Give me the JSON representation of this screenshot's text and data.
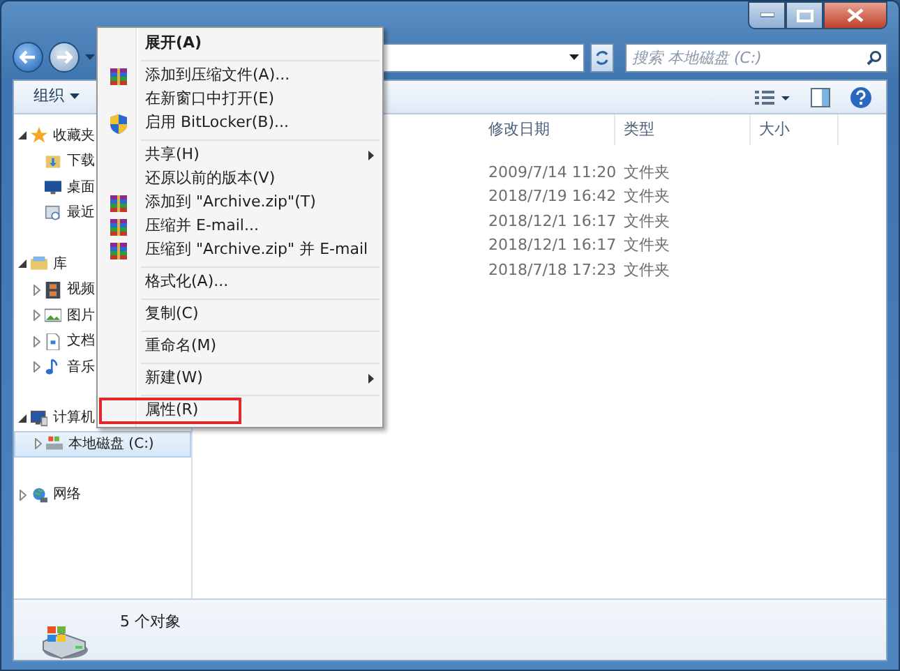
{
  "search": {
    "placeholder": "搜索 本地磁盘 (C:)"
  },
  "toolbar": {
    "organize": "组织"
  },
  "sidebar": [
    {
      "label": "收藏夹",
      "expanded": true,
      "selected": false,
      "children": [
        {
          "label": "下载",
          "selected": false
        },
        {
          "label": "桌面",
          "selected": false
        },
        {
          "label": "最近",
          "selected": false
        }
      ]
    },
    {
      "label": "库",
      "expanded": true,
      "selected": false,
      "children": [
        {
          "label": "视频",
          "expanded": false,
          "selected": false
        },
        {
          "label": "图片",
          "expanded": false,
          "selected": false
        },
        {
          "label": "文档",
          "expanded": false,
          "selected": false
        },
        {
          "label": "音乐",
          "expanded": false,
          "selected": false
        }
      ]
    },
    {
      "label": "计算机",
      "expanded": true,
      "selected": false,
      "children": [
        {
          "label": "本地磁盘 (C:)",
          "expanded": false,
          "selected": true
        }
      ]
    },
    {
      "label": "网络",
      "expanded": false,
      "selected": false
    }
  ],
  "table": {
    "columns": [
      "修改日期",
      "类型",
      "大小"
    ],
    "rows": [
      {
        "modified": "2009/7/14 11:20",
        "type": "文件夹"
      },
      {
        "modified": "2018/7/19 16:42",
        "type": "文件夹"
      },
      {
        "modified": "2018/12/1 16:17",
        "type": "文件夹"
      },
      {
        "modified": "2018/12/1 16:17",
        "type": "文件夹"
      },
      {
        "modified": "2018/7/18 17:23",
        "type": "文件夹"
      }
    ]
  },
  "status_bar": {
    "text": "5 个对象"
  },
  "context_menu": {
    "items": [
      {
        "kind": "plain",
        "label": "展开(A)",
        "bold": true,
        "submenu": false,
        "highlighted": false
      },
      {
        "kind": "separator"
      },
      {
        "kind": "archive",
        "label": "添加到压缩文件(A)...",
        "bold": false,
        "submenu": false,
        "highlighted": false
      },
      {
        "kind": "plain",
        "label": "在新窗口中打开(E)",
        "bold": false,
        "submenu": false,
        "highlighted": false
      },
      {
        "kind": "shield",
        "label": "启用 BitLocker(B)...",
        "bold": false,
        "submenu": false,
        "highlighted": false
      },
      {
        "kind": "separator"
      },
      {
        "kind": "plain",
        "label": "共享(H)",
        "bold": false,
        "submenu": true,
        "highlighted": false
      },
      {
        "kind": "plain",
        "label": "还原以前的版本(V)",
        "bold": false,
        "submenu": false,
        "highlighted": false
      },
      {
        "kind": "archive",
        "label": "添加到 \"Archive.zip\"(T)",
        "bold": false,
        "submenu": false,
        "highlighted": false
      },
      {
        "kind": "archive",
        "label": "压缩并 E-mail...",
        "bold": false,
        "submenu": false,
        "highlighted": false
      },
      {
        "kind": "archive",
        "label": "压缩到 \"Archive.zip\" 并 E-mail",
        "bold": false,
        "submenu": false,
        "highlighted": false
      },
      {
        "kind": "separator"
      },
      {
        "kind": "plain",
        "label": "格式化(A)...",
        "bold": false,
        "submenu": false,
        "highlighted": false
      },
      {
        "kind": "separator"
      },
      {
        "kind": "plain",
        "label": "复制(C)",
        "bold": false,
        "submenu": false,
        "highlighted": false
      },
      {
        "kind": "separator"
      },
      {
        "kind": "plain",
        "label": "重命名(M)",
        "bold": false,
        "submenu": false,
        "highlighted": false
      },
      {
        "kind": "separator"
      },
      {
        "kind": "plain",
        "label": "新建(W)",
        "bold": false,
        "submenu": true,
        "highlighted": false
      },
      {
        "kind": "separator"
      },
      {
        "kind": "plain",
        "label": "属性(R)",
        "bold": false,
        "submenu": false,
        "highlighted": true
      }
    ]
  }
}
